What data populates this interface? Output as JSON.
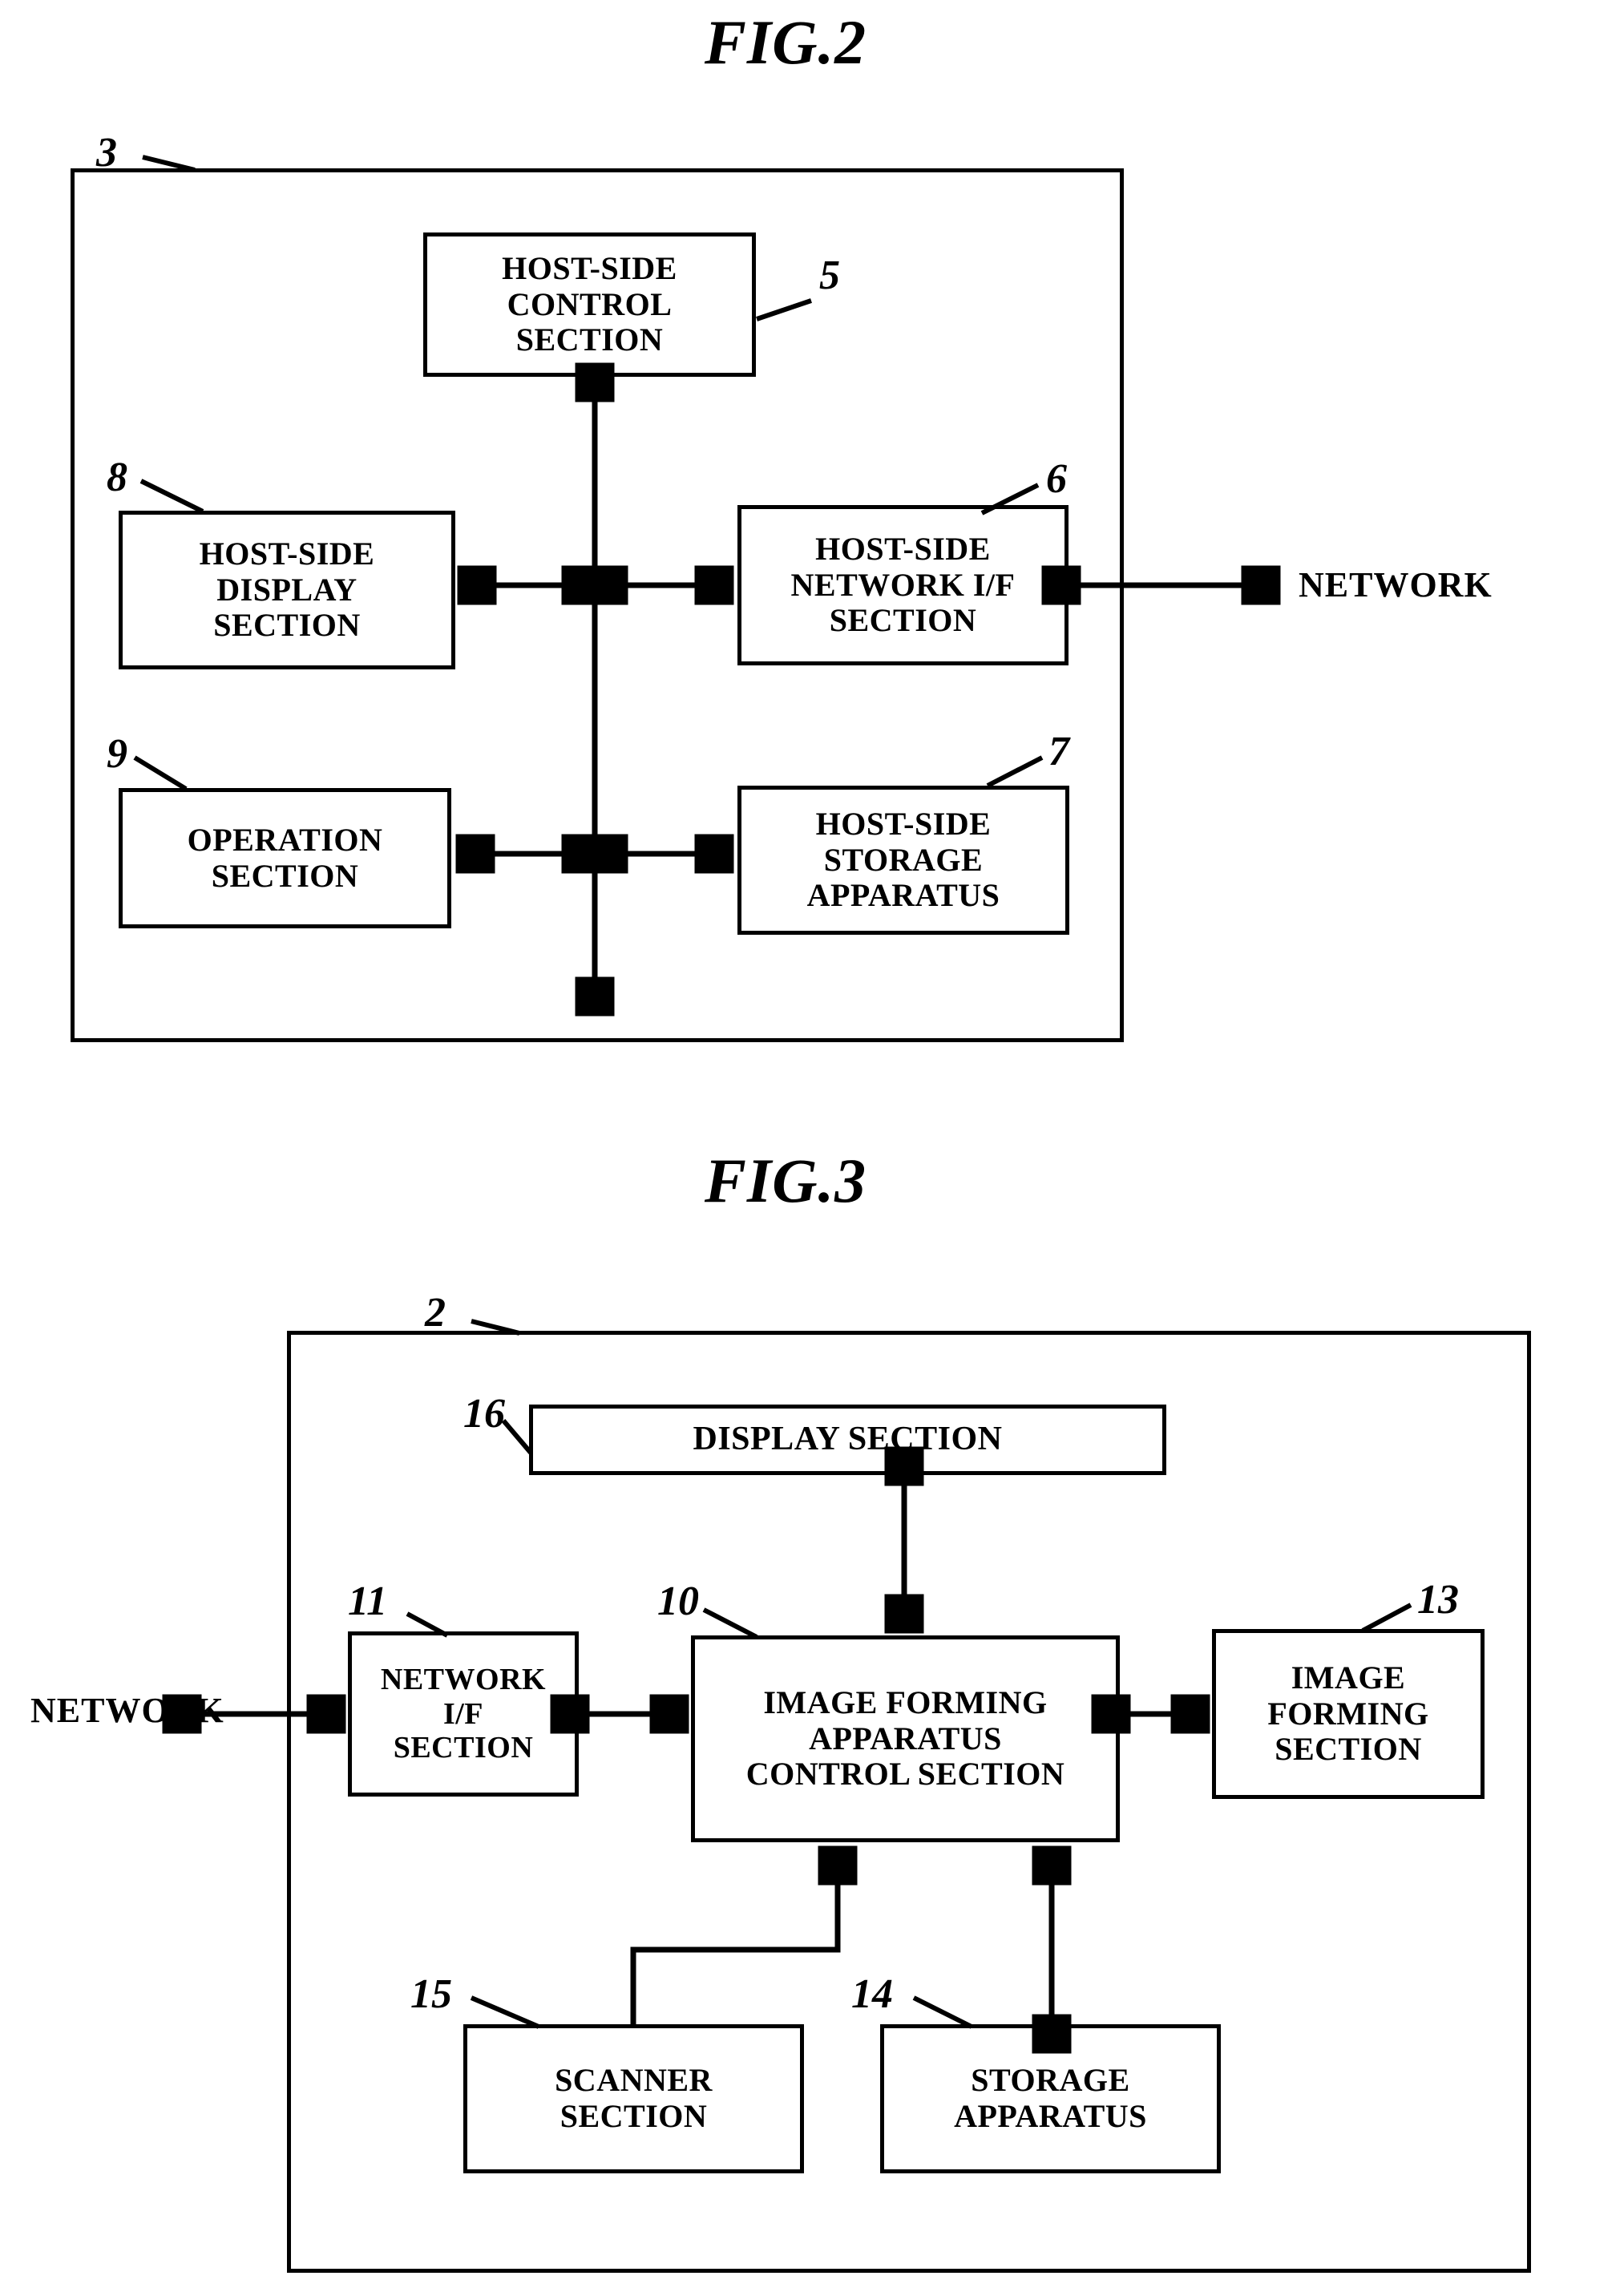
{
  "figures": [
    {
      "title": "FIG.2",
      "frame_label": "3",
      "blocks": [
        {
          "id": "host-side-control-section",
          "label": "HOST-SIDE\nCONTROL\nSECTION",
          "ref": "5"
        },
        {
          "id": "host-side-display-section",
          "label": "HOST-SIDE\nDISPLAY\nSECTION",
          "ref": "8"
        },
        {
          "id": "host-side-network-if-section",
          "label": "HOST-SIDE\nNETWORK I/F\nSECTION",
          "ref": "6"
        },
        {
          "id": "operation-section",
          "label": "OPERATION\nSECTION",
          "ref": "9"
        },
        {
          "id": "host-side-storage-apparatus",
          "label": "HOST-SIDE\nSTORAGE\nAPPARATUS",
          "ref": "7"
        }
      ],
      "external_labels": [
        {
          "id": "network-right",
          "text": "NETWORK"
        }
      ]
    },
    {
      "title": "FIG.3",
      "frame_label": "2",
      "blocks": [
        {
          "id": "display-section",
          "label": "DISPLAY SECTION",
          "ref": "16"
        },
        {
          "id": "network-if-section",
          "label": "NETWORK\nI/F\nSECTION",
          "ref": "11"
        },
        {
          "id": "image-forming-apparatus-control-section",
          "label": "IMAGE FORMING\nAPPARATUS\nCONTROL SECTION",
          "ref": "10"
        },
        {
          "id": "image-forming-section",
          "label": "IMAGE\nFORMING\nSECTION",
          "ref": "13"
        },
        {
          "id": "scanner-section",
          "label": "SCANNER\nSECTION",
          "ref": "15"
        },
        {
          "id": "storage-apparatus",
          "label": "STORAGE\nAPPARATUS",
          "ref": "14"
        }
      ],
      "external_labels": [
        {
          "id": "network-left",
          "text": "NETWORK"
        }
      ]
    }
  ],
  "fig2": {
    "title": "FIG.2",
    "frame_ref": "3",
    "control": {
      "label": "HOST-SIDE\nCONTROL\nSECTION",
      "ref": "5"
    },
    "display": {
      "label": "HOST-SIDE\nDISPLAY\nSECTION",
      "ref": "8"
    },
    "network_if": {
      "label": "HOST-SIDE\nNETWORK I/F\nSECTION",
      "ref": "6"
    },
    "operation": {
      "label": "OPERATION\nSECTION",
      "ref": "9"
    },
    "storage": {
      "label": "HOST-SIDE\nSTORAGE\nAPPARATUS",
      "ref": "7"
    },
    "network_text": "NETWORK"
  },
  "fig3": {
    "title": "FIG.3",
    "frame_ref": "2",
    "display": {
      "label": "DISPLAY SECTION",
      "ref": "16"
    },
    "network_if": {
      "label": "NETWORK\nI/F\nSECTION",
      "ref": "11"
    },
    "control": {
      "label": "IMAGE FORMING\nAPPARATUS\nCONTROL SECTION",
      "ref": "10"
    },
    "forming": {
      "label": "IMAGE\nFORMING\nSECTION",
      "ref": "13"
    },
    "scanner": {
      "label": "SCANNER\nSECTION",
      "ref": "15"
    },
    "storage": {
      "label": "STORAGE\nAPPARATUS",
      "ref": "14"
    },
    "network_text": "NETWORK"
  },
  "colors": {
    "ink": "#000000",
    "paper": "#ffffff"
  }
}
